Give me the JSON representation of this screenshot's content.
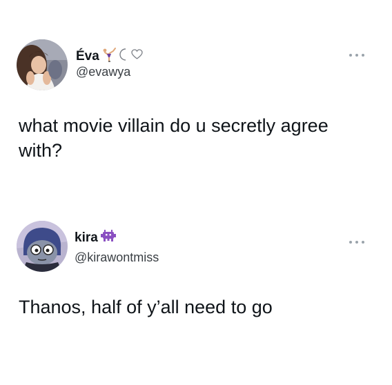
{
  "tweets": [
    {
      "display_name": "Éva",
      "name_emojis": [
        "gymnast-emoji",
        "crescent-moon-emoji",
        "white-heart-emoji"
      ],
      "handle": "@evawya",
      "text": "what movie villain do u secretly agree with?",
      "avatar": "profile-photo-woman"
    },
    {
      "display_name": "kira",
      "name_emojis": [
        "purple-alien-monster-emoji"
      ],
      "handle": "@kirawontmiss",
      "text": "Thanos, half of y’all need to go",
      "avatar": "cartoon-character-avatar"
    }
  ],
  "icons": {
    "more": "more-options-icon"
  },
  "colors": {
    "text": "#0f1419",
    "handle": "#3a3f44",
    "more_dots": "#9aa3ab"
  }
}
